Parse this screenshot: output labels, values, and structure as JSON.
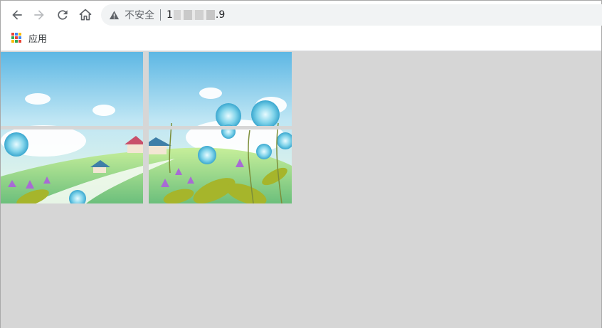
{
  "browser": {
    "security_label": "不安全",
    "url_prefix": "1",
    "url_suffix": ".9",
    "bookmark_apps_label": "应用",
    "colors": {
      "icon": "#5f6368",
      "icon_disabled": "#b8babd",
      "omnibox_bg": "#f1f3f4",
      "page_bg": "#d6d6d6"
    },
    "icons": [
      "back-arrow-icon",
      "forward-arrow-icon",
      "reload-icon",
      "home-icon",
      "warning-icon",
      "apps-grid-icon"
    ]
  },
  "page": {
    "image": {
      "description_icon": "illustration-image",
      "grid_rows": 2,
      "grid_cols": 2
    }
  }
}
